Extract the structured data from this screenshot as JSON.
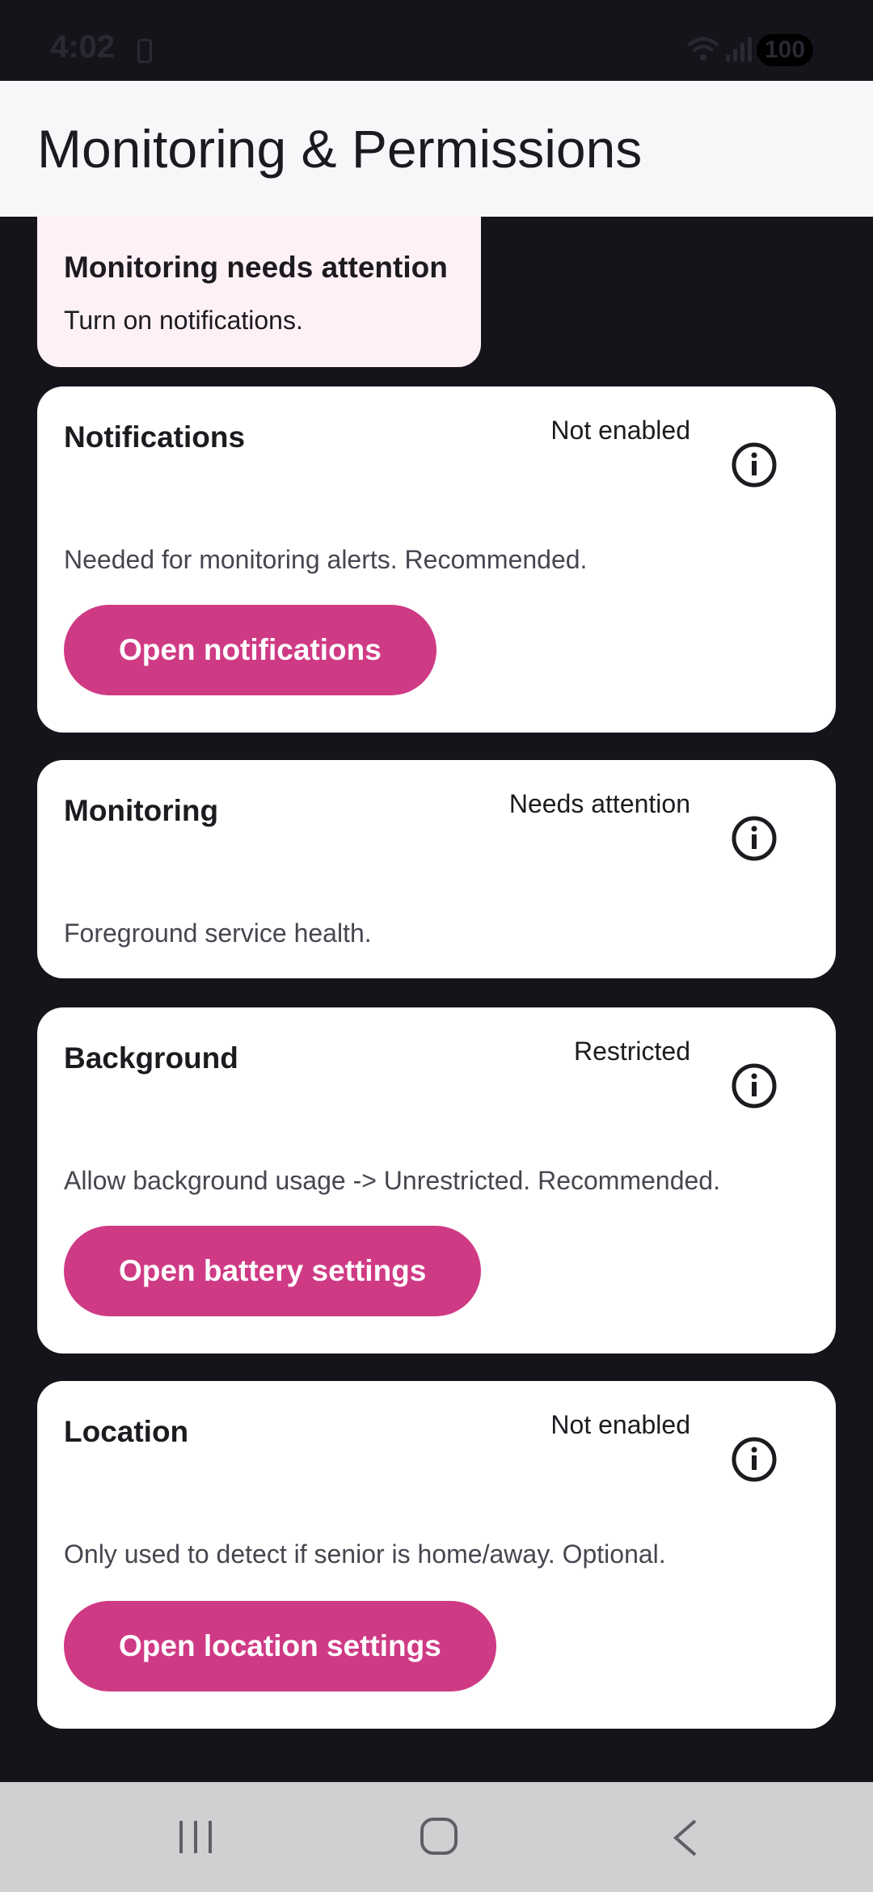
{
  "status_bar": {
    "time": "4:02",
    "battery": "100"
  },
  "app_bar": {
    "title": "Monitoring & Permissions"
  },
  "alert": {
    "title": "Monitoring needs attention",
    "body": "Turn on notifications."
  },
  "cards": [
    {
      "title": "Notifications",
      "status": "Not enabled",
      "description": "Needed for monitoring alerts. Recommended.",
      "button": "Open notifications"
    },
    {
      "title": "Monitoring",
      "status": "Needs attention",
      "description": "Foreground service health."
    },
    {
      "title": "Background",
      "status": "Restricted",
      "description": "Allow background usage -> Unrestricted. Recommended.",
      "button": "Open battery settings"
    },
    {
      "title": "Location",
      "status": "Not enabled",
      "description": "Only used to detect if senior is home/away. Optional.",
      "button": "Open location settings"
    }
  ],
  "colors": {
    "accent": "#cf3a85",
    "alert_bg": "#fdf1f6",
    "page_bg": "#16141b"
  },
  "icons": {
    "info": "info-icon",
    "nav_recent": "recent-apps-icon",
    "nav_home": "home-icon",
    "nav_back": "back-icon"
  }
}
